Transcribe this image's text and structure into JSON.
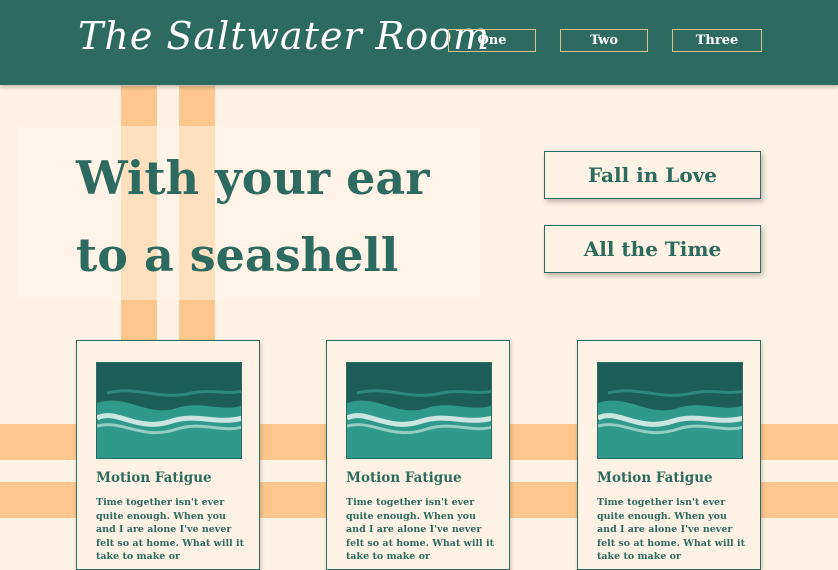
{
  "header": {
    "logo": "The Saltwater Room",
    "nav": [
      "One",
      "Two",
      "Three"
    ]
  },
  "hero": {
    "title_line1": "With your ear",
    "title_line2": "to a seashell"
  },
  "cta": [
    "Fall in Love",
    "All the Time"
  ],
  "cards": [
    {
      "title": "Motion Fatigue",
      "text": "Time together isn't ever quite enough. When you and I are alone I've never felt so at home. What will it take to make or"
    },
    {
      "title": "Motion Fatigue",
      "text": "Time together isn't ever quite enough. When you and I are alone I've never felt so at home. What will it take to make or"
    },
    {
      "title": "Motion Fatigue",
      "text": "Time together isn't ever quite enough. When you and I are alone I've never felt so at home. What will it take to make or"
    }
  ],
  "colors": {
    "primary": "#2d6a60",
    "background": "#fef2e4",
    "stripe": "#fcc68c",
    "nav_border": "#d6c08d"
  },
  "icons": {
    "card_image": "ocean-waves-image"
  }
}
